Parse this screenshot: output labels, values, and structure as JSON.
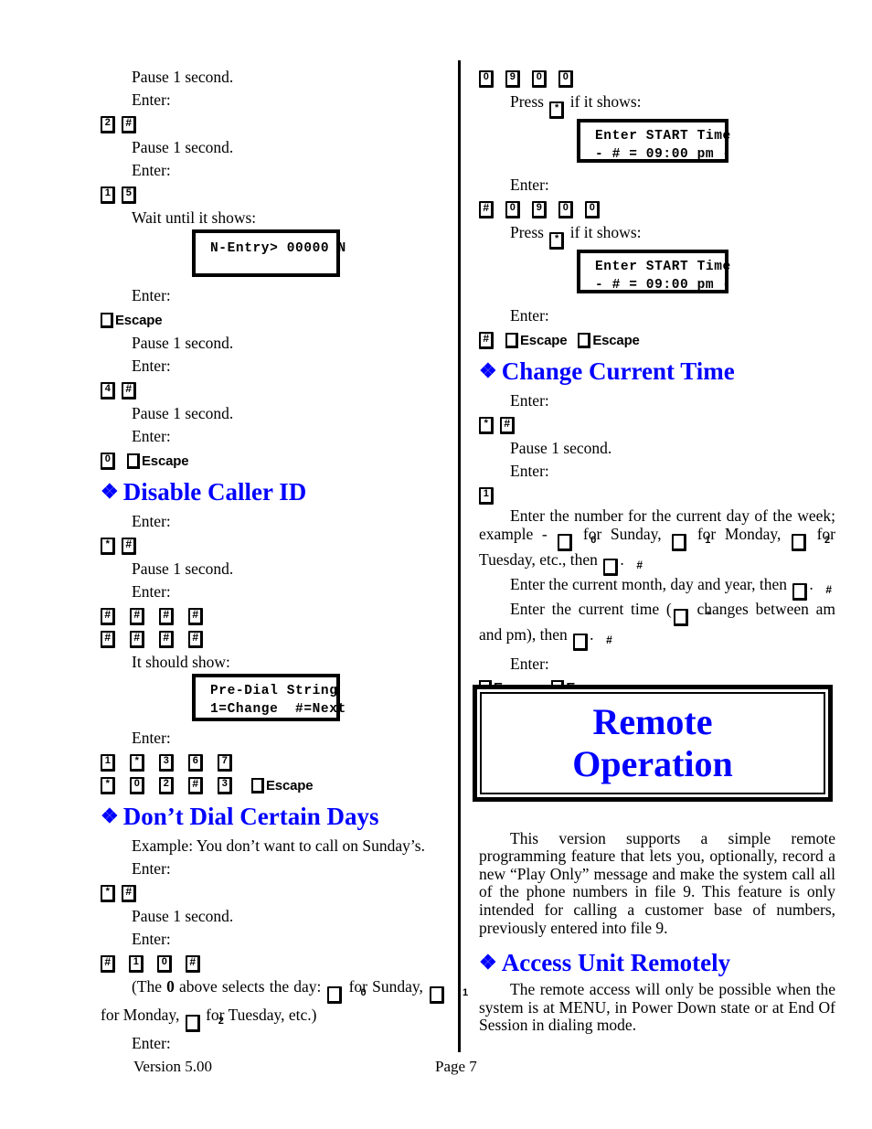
{
  "document": {
    "footer": {
      "version": "Version 5.00",
      "page": "Page 7"
    },
    "colors": {
      "heading_blue": "#0000ff",
      "text_black": "#000000",
      "background": "#ffffff"
    }
  },
  "left_column": {
    "l1_pause": "Pause 1 second.",
    "l2_enter": "Enter:",
    "keys_2_hash": [
      "2",
      "#"
    ],
    "l3_pause": "Pause 1 second.",
    "l4_enter": "Enter:",
    "keys_1_5": [
      "1",
      "5"
    ],
    "l5_wait": "Wait until it shows:",
    "lcd_nentry": "N-Entry> 00000 N",
    "l6_enter": "Enter:",
    "escape_1": "Escape",
    "l7_pause": "Pause 1 second.",
    "l8_enter": "Enter:",
    "keys_4_hash": [
      "4",
      "#"
    ],
    "l9_pause": "Pause 1 second.",
    "l10_enter": "Enter:",
    "keys_0": [
      "0"
    ],
    "escape_2": "Escape",
    "heading_disable_caller_id": "Disable Caller ID",
    "l11_enter": "Enter:",
    "keys_star_hash": [
      "*",
      "#"
    ],
    "l12_pause": "Pause 1 second.",
    "l13_enter": "Enter:",
    "keys_hash_row1": [
      "#",
      "#",
      "#",
      "#"
    ],
    "keys_hash_row2": [
      "#",
      "#",
      "#",
      "#"
    ],
    "l14_should_show": "It should show:",
    "lcd_predial_line1": "Pre-Dial String",
    "lcd_predial_line2": "1=Change  #=Next",
    "l15_enter": "Enter:",
    "keys_seq_row1": [
      "1",
      "*",
      "3",
      "6",
      "7"
    ],
    "keys_seq_row2": [
      "*",
      "0",
      "2",
      "#",
      "3"
    ],
    "escape_3": "Escape",
    "heading_dont_dial": "Don’t Dial Certain Days",
    "l16_example": "Example:  You don’t want to call on Sunday’s.",
    "l17_enter": "Enter:",
    "keys_star_hash_2": [
      "*",
      "#"
    ],
    "l18_pause": "Pause 1 second.",
    "l19_enter": "Enter:",
    "keys_hash_1_0_hash": [
      "#",
      "1",
      "0",
      "#"
    ],
    "note_part1": "(The ",
    "note_bold0": "0",
    "note_part2": " above selects the day:  ",
    "note_key_0": "0",
    "note_part3": " for Sunday, ",
    "note_key_1": "1",
    "note_part4": " for Monday, ",
    "note_key_2": "2",
    "note_part5": " for Tuesday, etc.)",
    "l20_enter": "Enter:"
  },
  "right_column": {
    "keys_0900_row1": [
      "0",
      "9",
      "0",
      "0"
    ],
    "r1_press_pre": "Press ",
    "r1_press_key": "*",
    "r1_press_post": " if it shows:",
    "lcd_start_1_line1": "Enter START Time",
    "lcd_start_1_line2": "- # = 09:00 pm -",
    "r2_enter": "Enter:",
    "keys_hash_0900_row": [
      "#",
      "0",
      "9",
      "0",
      "0"
    ],
    "r3_press_pre": "Press ",
    "r3_press_key": "*",
    "r3_press_post": " if it shows:",
    "lcd_start_2_line1": "Enter START Time",
    "lcd_start_2_line2": "- # = 09:00 pm -",
    "r4_enter": "Enter:",
    "keys_hash_single": [
      "#"
    ],
    "escape_a": "Escape",
    "escape_b": "Escape",
    "heading_change_current_time": "Change Current Time",
    "r5_enter": "Enter:",
    "keys_star_hash": [
      "*",
      "#"
    ],
    "r6_pause": "Pause 1 second.",
    "r7_enter": "Enter:",
    "keys_1": [
      "1"
    ],
    "p1_a": "Enter the number for the current day of the week; example - ",
    "p1_key0": "0",
    "p1_b": " for Sunday, ",
    "p1_key1": "1",
    "p1_c": " for Monday, ",
    "p1_key2": "2",
    "p1_d": " for Tuesday, etc., then ",
    "p1_keyhash": "#",
    "p1_e": ".",
    "p2_a": "Enter the current month, day and year, then ",
    "p2_keyhash": "#",
    "p2_b": ".",
    "p3_a": "Enter the current time (",
    "p3_keystar": "*",
    "p3_b": " changes between am and pm), then ",
    "p3_keyhash": "#",
    "p3_c": ".",
    "r8_enter": "Enter:",
    "escape_c": "Escape",
    "escape_d": "Escape",
    "titlebox_line1": "Remote",
    "titlebox_line2": "Operation",
    "body_para_1": "This version supports a simple remote programming feature that lets you, optionally, record a new “Play Only” message and make the system call all of the phone numbers in file 9.  This feature is only intended for calling a customer base of numbers, previously entered into file 9.",
    "heading_access_unit_remotely": "Access Unit Remotely",
    "body_para_2": "The remote access will only be possible when the system is at MENU, in Power Down state or at End Of Session in dialing mode."
  }
}
